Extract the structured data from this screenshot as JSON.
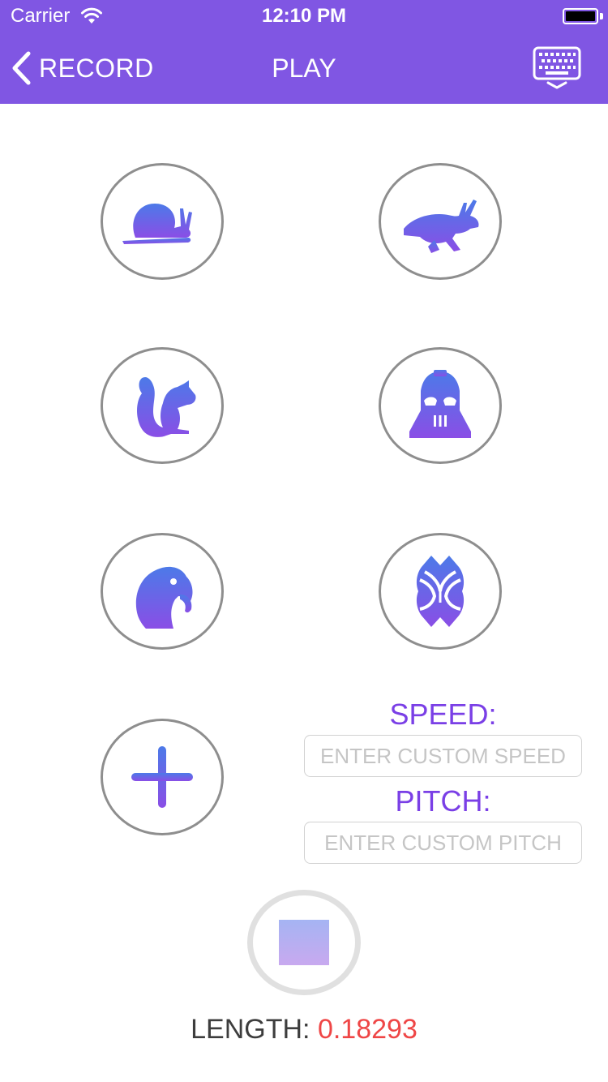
{
  "status_bar": {
    "carrier": "Carrier",
    "time": "12:10 PM"
  },
  "nav": {
    "back_label": "RECORD",
    "title": "PLAY"
  },
  "effects": [
    {
      "icon": "snail-icon"
    },
    {
      "icon": "rabbit-icon"
    },
    {
      "icon": "squirrel-icon"
    },
    {
      "icon": "darth-vader-icon"
    },
    {
      "icon": "parrot-icon"
    },
    {
      "icon": "reverb-icon"
    },
    {
      "icon": "plus-icon"
    }
  ],
  "custom": {
    "speed_label": "SPEED:",
    "speed_placeholder": "ENTER CUSTOM SPEED",
    "pitch_label": "PITCH:",
    "pitch_placeholder": "ENTER CUSTOM PITCH"
  },
  "length": {
    "label": "LENGTH:",
    "value": "0.18293"
  },
  "colors": {
    "header": "#8056e3",
    "icon_gradient_top": "#4c7ae8",
    "icon_gradient_bottom": "#8a4ee6",
    "length_value": "#ef4646"
  }
}
